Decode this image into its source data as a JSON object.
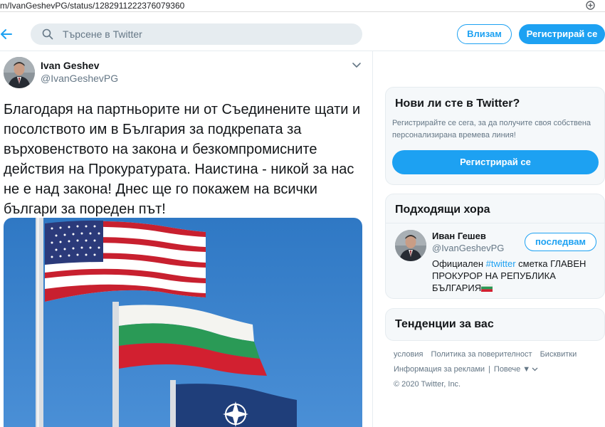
{
  "browser": {
    "url": "m/IvanGeshevPG/status/1282911222376079360"
  },
  "header": {
    "search_placeholder": "Търсене в Twitter",
    "login_label": "Влизам",
    "signup_label": "Регистрирай се"
  },
  "tweet": {
    "author_name": "Ivan Geshev",
    "author_handle": "@IvanGeshevPG",
    "text": "Благодаря на партньорите ни от Съединените щати и посолството им в България за подкрепата за върховенството на закона и безкомпромисните действия на Прокуратурата. Наистина - никой за нас не е над закона! Днес ще го покажем на всички българи за пореден път!",
    "photo_icon": "flags-photo"
  },
  "sidebar": {
    "new_card": {
      "title": "Нови ли сте в Twitter?",
      "description": "Регистрирайте се сега, за да получите своя собствена персонализирана времева линия!",
      "button_label": "Регистрирай се"
    },
    "people_card": {
      "title": "Подходящи хора",
      "person": {
        "name": "Иван Гешев",
        "handle": "@IvanGeshevPG",
        "follow_label": "последвам",
        "bio_before": "Официален ",
        "bio_hashtag": "#twitter",
        "bio_after": " сметка ГЛАВЕН ПРОКУРОР НА РЕПУБЛИКА БЪЛГАРИЯ"
      }
    },
    "trends_card": {
      "title": "Тенденции за вас"
    },
    "footer": {
      "links_row1": [
        "условия",
        "Политика за поверителност",
        "Бисквитки"
      ],
      "ads_info": "Информация за реклами",
      "separator": "|",
      "more": "Повече ▼",
      "copyright": "© 2020 Twitter, Inc."
    }
  },
  "colors": {
    "accent": "#1da1f2",
    "secondary_text": "#657786",
    "card_bg": "#f5f8fa",
    "search_bg": "#e6ecf0"
  }
}
